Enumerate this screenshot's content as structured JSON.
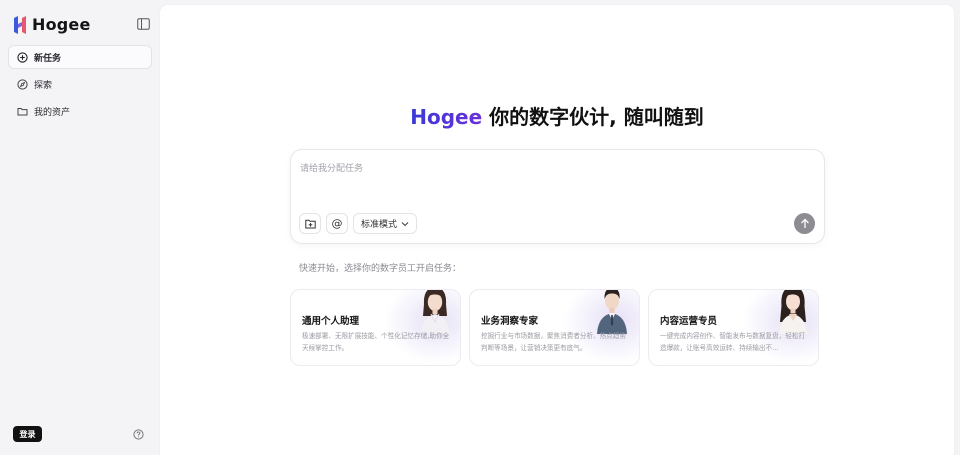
{
  "sidebar": {
    "logo_text": "Hogee",
    "logo_colors": [
      "#3b5bdb",
      "#e8566e"
    ],
    "items": [
      {
        "label": "新任务",
        "icon": "plus-circle-icon",
        "active": true
      },
      {
        "label": "探索",
        "icon": "compass-icon",
        "active": false
      },
      {
        "label": "我的资产",
        "icon": "folder-icon",
        "active": false
      }
    ],
    "login_label": "登录",
    "help_icon": "question-circle-icon"
  },
  "main": {
    "hero": {
      "brand": "Hogee",
      "title": "你的数字伙计, 随叫随到"
    },
    "composer": {
      "placeholder": "请给我分配任务",
      "mention_symbol": "@",
      "mode_label": "标准模式"
    },
    "quick_start_label": "快速开始，选择你的数字员工开启任务：",
    "cards": [
      {
        "title": "通用个人助理",
        "desc": "极速部署、无限扩展技能、个性化记忆存储,助你全天候掌控工作。"
      },
      {
        "title": "业务洞察专家",
        "desc": "挖掘行业与市场数据，聚焦消费者分析、热点趋势判断等场景，让营销决策更有底气。"
      },
      {
        "title": "内容运营专员",
        "desc": "一键完成内容创作、智能发布与数据复盘，轻松打造爆款，让账号高效运转、持续输出不..."
      }
    ]
  },
  "colors": {
    "brand_gradient_start": "#3a39d8",
    "brand_gradient_end": "#6b2fd9",
    "send_button": "#8c8c92"
  }
}
